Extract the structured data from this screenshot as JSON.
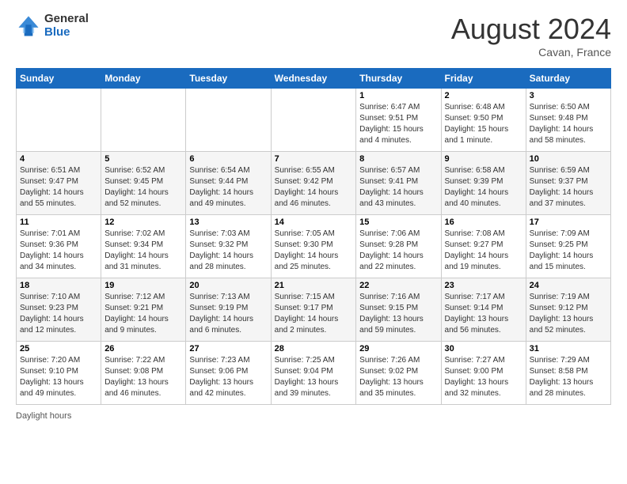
{
  "header": {
    "logo_general": "General",
    "logo_blue": "Blue",
    "month_title": "August 2024",
    "subtitle": "Cavan, France"
  },
  "days_of_week": [
    "Sunday",
    "Monday",
    "Tuesday",
    "Wednesday",
    "Thursday",
    "Friday",
    "Saturday"
  ],
  "weeks": [
    [
      {
        "day": "",
        "info": ""
      },
      {
        "day": "",
        "info": ""
      },
      {
        "day": "",
        "info": ""
      },
      {
        "day": "",
        "info": ""
      },
      {
        "day": "1",
        "info": "Sunrise: 6:47 AM\nSunset: 9:51 PM\nDaylight: 15 hours\nand 4 minutes."
      },
      {
        "day": "2",
        "info": "Sunrise: 6:48 AM\nSunset: 9:50 PM\nDaylight: 15 hours\nand 1 minute."
      },
      {
        "day": "3",
        "info": "Sunrise: 6:50 AM\nSunset: 9:48 PM\nDaylight: 14 hours\nand 58 minutes."
      }
    ],
    [
      {
        "day": "4",
        "info": "Sunrise: 6:51 AM\nSunset: 9:47 PM\nDaylight: 14 hours\nand 55 minutes."
      },
      {
        "day": "5",
        "info": "Sunrise: 6:52 AM\nSunset: 9:45 PM\nDaylight: 14 hours\nand 52 minutes."
      },
      {
        "day": "6",
        "info": "Sunrise: 6:54 AM\nSunset: 9:44 PM\nDaylight: 14 hours\nand 49 minutes."
      },
      {
        "day": "7",
        "info": "Sunrise: 6:55 AM\nSunset: 9:42 PM\nDaylight: 14 hours\nand 46 minutes."
      },
      {
        "day": "8",
        "info": "Sunrise: 6:57 AM\nSunset: 9:41 PM\nDaylight: 14 hours\nand 43 minutes."
      },
      {
        "day": "9",
        "info": "Sunrise: 6:58 AM\nSunset: 9:39 PM\nDaylight: 14 hours\nand 40 minutes."
      },
      {
        "day": "10",
        "info": "Sunrise: 6:59 AM\nSunset: 9:37 PM\nDaylight: 14 hours\nand 37 minutes."
      }
    ],
    [
      {
        "day": "11",
        "info": "Sunrise: 7:01 AM\nSunset: 9:36 PM\nDaylight: 14 hours\nand 34 minutes."
      },
      {
        "day": "12",
        "info": "Sunrise: 7:02 AM\nSunset: 9:34 PM\nDaylight: 14 hours\nand 31 minutes."
      },
      {
        "day": "13",
        "info": "Sunrise: 7:03 AM\nSunset: 9:32 PM\nDaylight: 14 hours\nand 28 minutes."
      },
      {
        "day": "14",
        "info": "Sunrise: 7:05 AM\nSunset: 9:30 PM\nDaylight: 14 hours\nand 25 minutes."
      },
      {
        "day": "15",
        "info": "Sunrise: 7:06 AM\nSunset: 9:28 PM\nDaylight: 14 hours\nand 22 minutes."
      },
      {
        "day": "16",
        "info": "Sunrise: 7:08 AM\nSunset: 9:27 PM\nDaylight: 14 hours\nand 19 minutes."
      },
      {
        "day": "17",
        "info": "Sunrise: 7:09 AM\nSunset: 9:25 PM\nDaylight: 14 hours\nand 15 minutes."
      }
    ],
    [
      {
        "day": "18",
        "info": "Sunrise: 7:10 AM\nSunset: 9:23 PM\nDaylight: 14 hours\nand 12 minutes."
      },
      {
        "day": "19",
        "info": "Sunrise: 7:12 AM\nSunset: 9:21 PM\nDaylight: 14 hours\nand 9 minutes."
      },
      {
        "day": "20",
        "info": "Sunrise: 7:13 AM\nSunset: 9:19 PM\nDaylight: 14 hours\nand 6 minutes."
      },
      {
        "day": "21",
        "info": "Sunrise: 7:15 AM\nSunset: 9:17 PM\nDaylight: 14 hours\nand 2 minutes."
      },
      {
        "day": "22",
        "info": "Sunrise: 7:16 AM\nSunset: 9:15 PM\nDaylight: 13 hours\nand 59 minutes."
      },
      {
        "day": "23",
        "info": "Sunrise: 7:17 AM\nSunset: 9:14 PM\nDaylight: 13 hours\nand 56 minutes."
      },
      {
        "day": "24",
        "info": "Sunrise: 7:19 AM\nSunset: 9:12 PM\nDaylight: 13 hours\nand 52 minutes."
      }
    ],
    [
      {
        "day": "25",
        "info": "Sunrise: 7:20 AM\nSunset: 9:10 PM\nDaylight: 13 hours\nand 49 minutes."
      },
      {
        "day": "26",
        "info": "Sunrise: 7:22 AM\nSunset: 9:08 PM\nDaylight: 13 hours\nand 46 minutes."
      },
      {
        "day": "27",
        "info": "Sunrise: 7:23 AM\nSunset: 9:06 PM\nDaylight: 13 hours\nand 42 minutes."
      },
      {
        "day": "28",
        "info": "Sunrise: 7:25 AM\nSunset: 9:04 PM\nDaylight: 13 hours\nand 39 minutes."
      },
      {
        "day": "29",
        "info": "Sunrise: 7:26 AM\nSunset: 9:02 PM\nDaylight: 13 hours\nand 35 minutes."
      },
      {
        "day": "30",
        "info": "Sunrise: 7:27 AM\nSunset: 9:00 PM\nDaylight: 13 hours\nand 32 minutes."
      },
      {
        "day": "31",
        "info": "Sunrise: 7:29 AM\nSunset: 8:58 PM\nDaylight: 13 hours\nand 28 minutes."
      }
    ]
  ],
  "legend": {
    "daylight_hours": "Daylight hours"
  }
}
